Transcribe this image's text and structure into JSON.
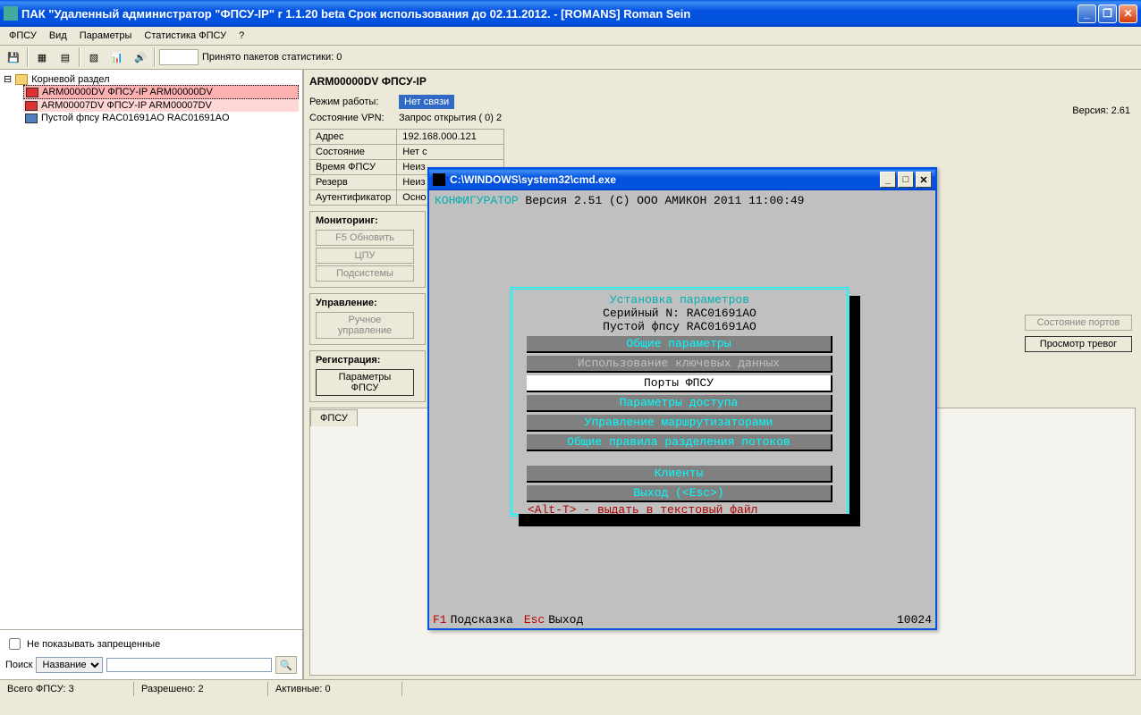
{
  "window": {
    "title": "ПАК \"Удаленный администратор \"ФПСУ-IP\" r 1.1.20 beta  Срок использования до 02.11.2012. - [ROMANS] Roman Sein"
  },
  "menu": [
    "ФПСУ",
    "Вид",
    "Параметры",
    "Статистика ФПСУ",
    "?"
  ],
  "toolbar": {
    "stat_label": "Принято пакетов статистики:  0"
  },
  "tree": {
    "root": "Корневой раздел",
    "items": [
      {
        "label": "ARM00000DV ФПСУ-IP ARM00000DV",
        "color": "red",
        "sel": "red"
      },
      {
        "label": "ARM00007DV ФПСУ-IP ARM00007DV",
        "color": "red",
        "sel": "pink"
      },
      {
        "label": "Пустой фпсу RAC01691AO RAC01691AO",
        "color": "blue",
        "sel": ""
      }
    ]
  },
  "sidebar": {
    "hide_forbidden": "Не показывать запрещенные",
    "search_label": "Поиск",
    "search_select": "Название"
  },
  "content": {
    "title": "ARM00000DV ФПСУ-IP",
    "mode_label": "Режим работы:",
    "mode_value": "Нет связи",
    "vpn_label": "Состояние VPN:",
    "vpn_value": "Запрос открытия ( 0) 2",
    "version": "Версия: 2.61",
    "props": [
      [
        "Адрес",
        "192.168.000.121"
      ],
      [
        "Состояние",
        "Нет с"
      ],
      [
        "Время ФПСУ",
        "Неиз"
      ],
      [
        "Резерв",
        "Неиз"
      ],
      [
        "Аутентификатор",
        "Осно"
      ]
    ],
    "monitoring_title": "Мониторинг:",
    "btn_refresh": "F5 Обновить",
    "btn_cpu": "ЦПУ",
    "btn_subsys": "Подсистемы",
    "manage_title": "Управление:",
    "btn_manual": "Ручное управление",
    "reg_title": "Регистрация:",
    "btn_params": "Параметры ФПСУ",
    "btn_ports": "Состояние портов",
    "btn_alarms": "Просмотр тревог",
    "tab_label": "ФПСУ"
  },
  "cmd": {
    "title": "C:\\WINDOWS\\system32\\cmd.exe",
    "cfg": "КОНФИГУРАТОР",
    "topline": " Версия 2.51   (C) ООО АМИКОН 2011          11:00:49",
    "box_title": "Установка параметров",
    "serial1": "Серийный N: RAC01691AO",
    "serial2": "Пустой фпсу RAC01691AO",
    "items": [
      {
        "t": "Общие параметры",
        "cls": ""
      },
      {
        "t": "Использование ключевых данных",
        "cls": "gray"
      },
      {
        "t": "Порты ФПСУ",
        "cls": "selected"
      },
      {
        "t": "Параметры доступа",
        "cls": ""
      },
      {
        "t": "Управление маршрутизаторами",
        "cls": ""
      },
      {
        "t": "Общие правила разделения потоков",
        "cls": ""
      }
    ],
    "items2": [
      {
        "t": "Клиенты",
        "cls": ""
      },
      {
        "t": "Выход (<Esc>)",
        "cls": ""
      }
    ],
    "altline": "<Alt-T> - выдать в текстовый файл",
    "f1": "F1",
    "f1txt": "Подсказка",
    "esc": "Esc",
    "esctxt": "Выход",
    "num": "10024"
  },
  "status": {
    "total": "Всего ФПСУ: 3",
    "allowed": "Разрешено: 2",
    "active": "Активные: 0"
  }
}
